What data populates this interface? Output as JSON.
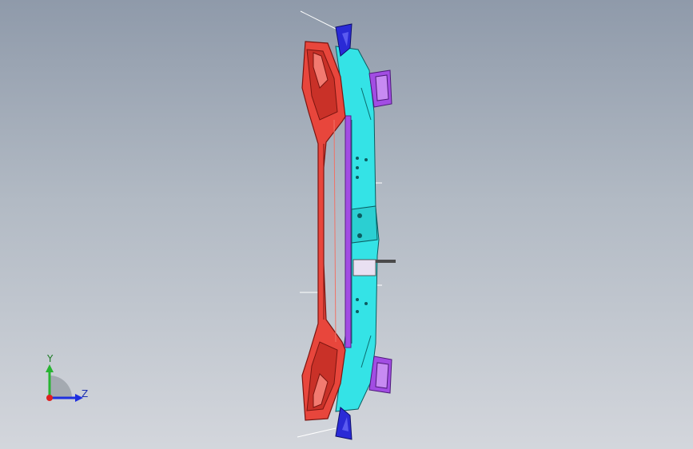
{
  "viewport": {
    "background_top": "#8f9aaa",
    "background_bottom": "#d3d6dc"
  },
  "model": {
    "parts": [
      {
        "name": "bumper-beam",
        "color": "#e8463c"
      },
      {
        "name": "bracket-frame",
        "color": "#34e3e6"
      },
      {
        "name": "mount-brackets",
        "color": "#a24de3"
      },
      {
        "name": "end-clips",
        "color": "#2a2ad6"
      }
    ]
  },
  "triad": {
    "y_label": "Y",
    "z_label": "Z",
    "y_color": "#28b432",
    "z_color": "#1e2fe0",
    "x_color": "#e02020"
  }
}
